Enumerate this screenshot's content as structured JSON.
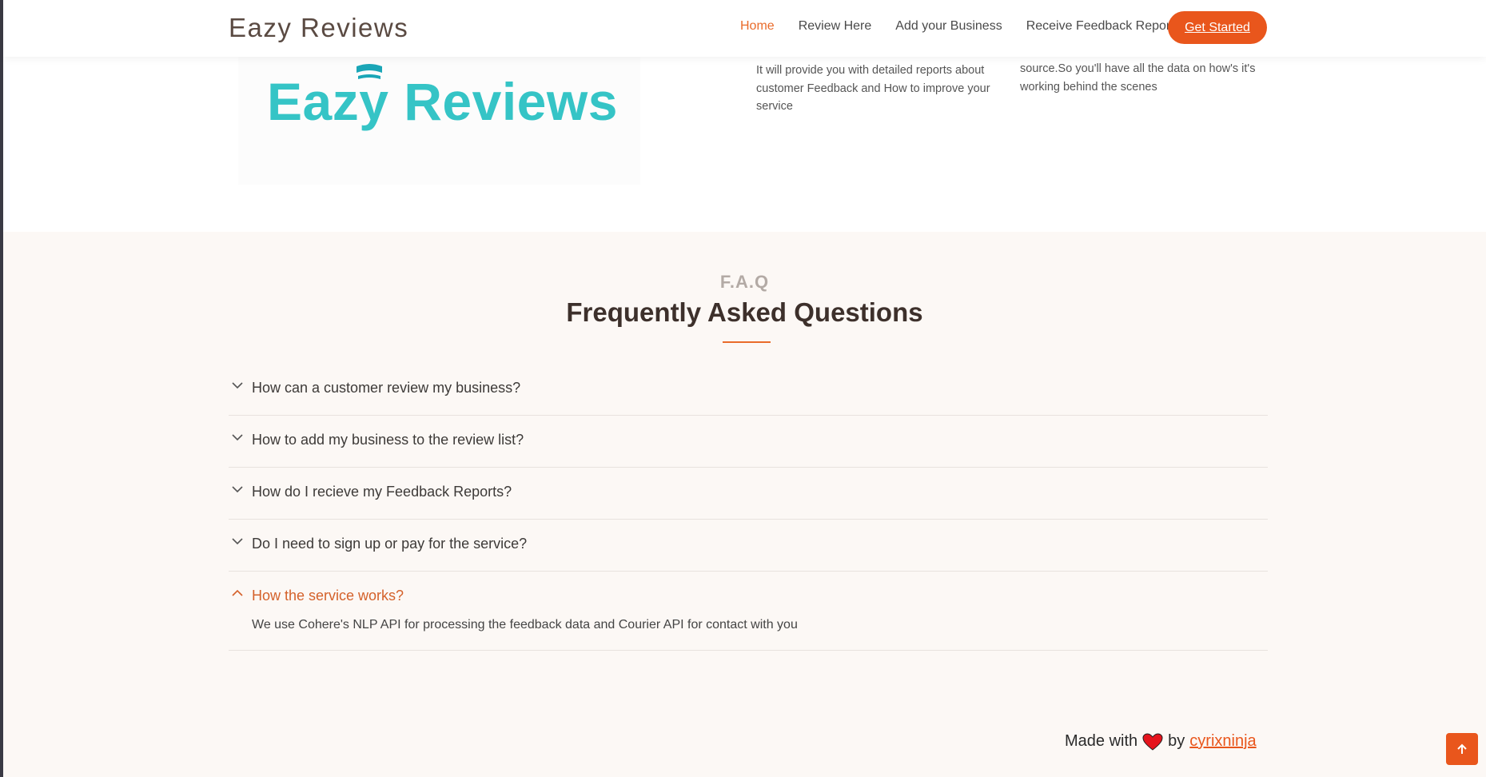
{
  "header": {
    "brand": "Eazy Reviews",
    "nav": [
      "Home",
      "Review Here",
      "Add your Business",
      "Receive Feedback Reports"
    ],
    "cta": "Get Started"
  },
  "about": {
    "logo_text": "Eazy Reviews",
    "col1": "It will provide you with detailed reports about customer Feedback and How to improve your service",
    "col2": "source.So you'll have all the data on how's it's working behind the scenes"
  },
  "faq": {
    "subtitle": "F.A.Q",
    "title": "Frequently Asked Questions",
    "items": [
      {
        "q": "How can a customer review my business?"
      },
      {
        "q": "How to add my business to the review list?"
      },
      {
        "q": "How do I recieve my Feedback Reports?"
      },
      {
        "q": "Do I need to sign up or pay for the service?"
      },
      {
        "q": "How the service works?",
        "a": "We use Cohere's NLP API for processing the feedback data and Courier API for contact with you"
      }
    ]
  },
  "footer": {
    "made_with": "Made with",
    "by": "by",
    "author": "cyrixninja"
  },
  "colors": {
    "accent": "#e9561c",
    "logo": "#35c4c6",
    "faq_bg": "#fcf8f5"
  },
  "icons": [
    "chevron-down-icon",
    "chevron-up-icon",
    "heart-icon",
    "arrow-up-icon"
  ]
}
